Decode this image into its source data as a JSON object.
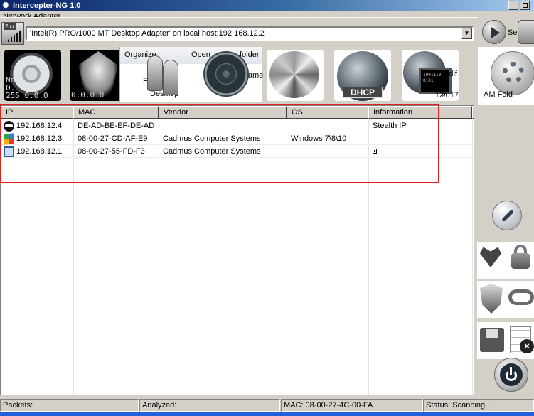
{
  "window": {
    "title": "Intercepter-NG 1.0"
  },
  "adapter": {
    "group_label": "Network Adapter",
    "selected": "'Intel(R) PRO/1000 MT Desktop Adapter' on local host:192.168.12.2",
    "icon": "network-adapter-icon"
  },
  "toolbar_fragments": {
    "organize": "Organize",
    "open": "Open",
    "folder": "folder",
    "favorites": "Favo",
    "desktop": "Desktop",
    "name": "Name",
    "modified": "odif",
    "date": "12/",
    "year": "2017",
    "am": "AM",
    "folder2": "Fold",
    "se": "Se",
    "flower_overlay": "Ne\n0.\n255 0.0.0",
    "bird_overlay": "0.0.0.0",
    "dhcp": "DHCP"
  },
  "hosts_table": {
    "columns": [
      "IP",
      "MAC",
      "Vendor",
      "OS",
      "Information"
    ],
    "rows": [
      {
        "icon": "stealth-ninja-icon",
        "ip": "192.168.12.4",
        "mac": "DE-AD-BE-EF-DE-AD",
        "vendor": "",
        "os": "",
        "info": "Stealth IP"
      },
      {
        "icon": "windows-logo-icon",
        "ip": "192.168.12.3",
        "mac": "08-00-27-CD-AF-E9",
        "vendor": "Cadmus Computer Systems",
        "os": "Windows 7\\8\\10",
        "info": ""
      },
      {
        "icon": "computer-icon",
        "ip": "192.168.12.1",
        "mac": "08-00-27-55-FD-F3",
        "vendor": "Cadmus Computer Systems",
        "os": "",
        "info": ""
      }
    ]
  },
  "status": {
    "packets": "Packets:",
    "analyzed": "Analyzed:",
    "mac": "MAC: 08-00-27-4C-00-FA",
    "state": "Status: Scanning..."
  },
  "colors": {
    "highlight": "#e02020",
    "title_bar": "#0a246a"
  }
}
